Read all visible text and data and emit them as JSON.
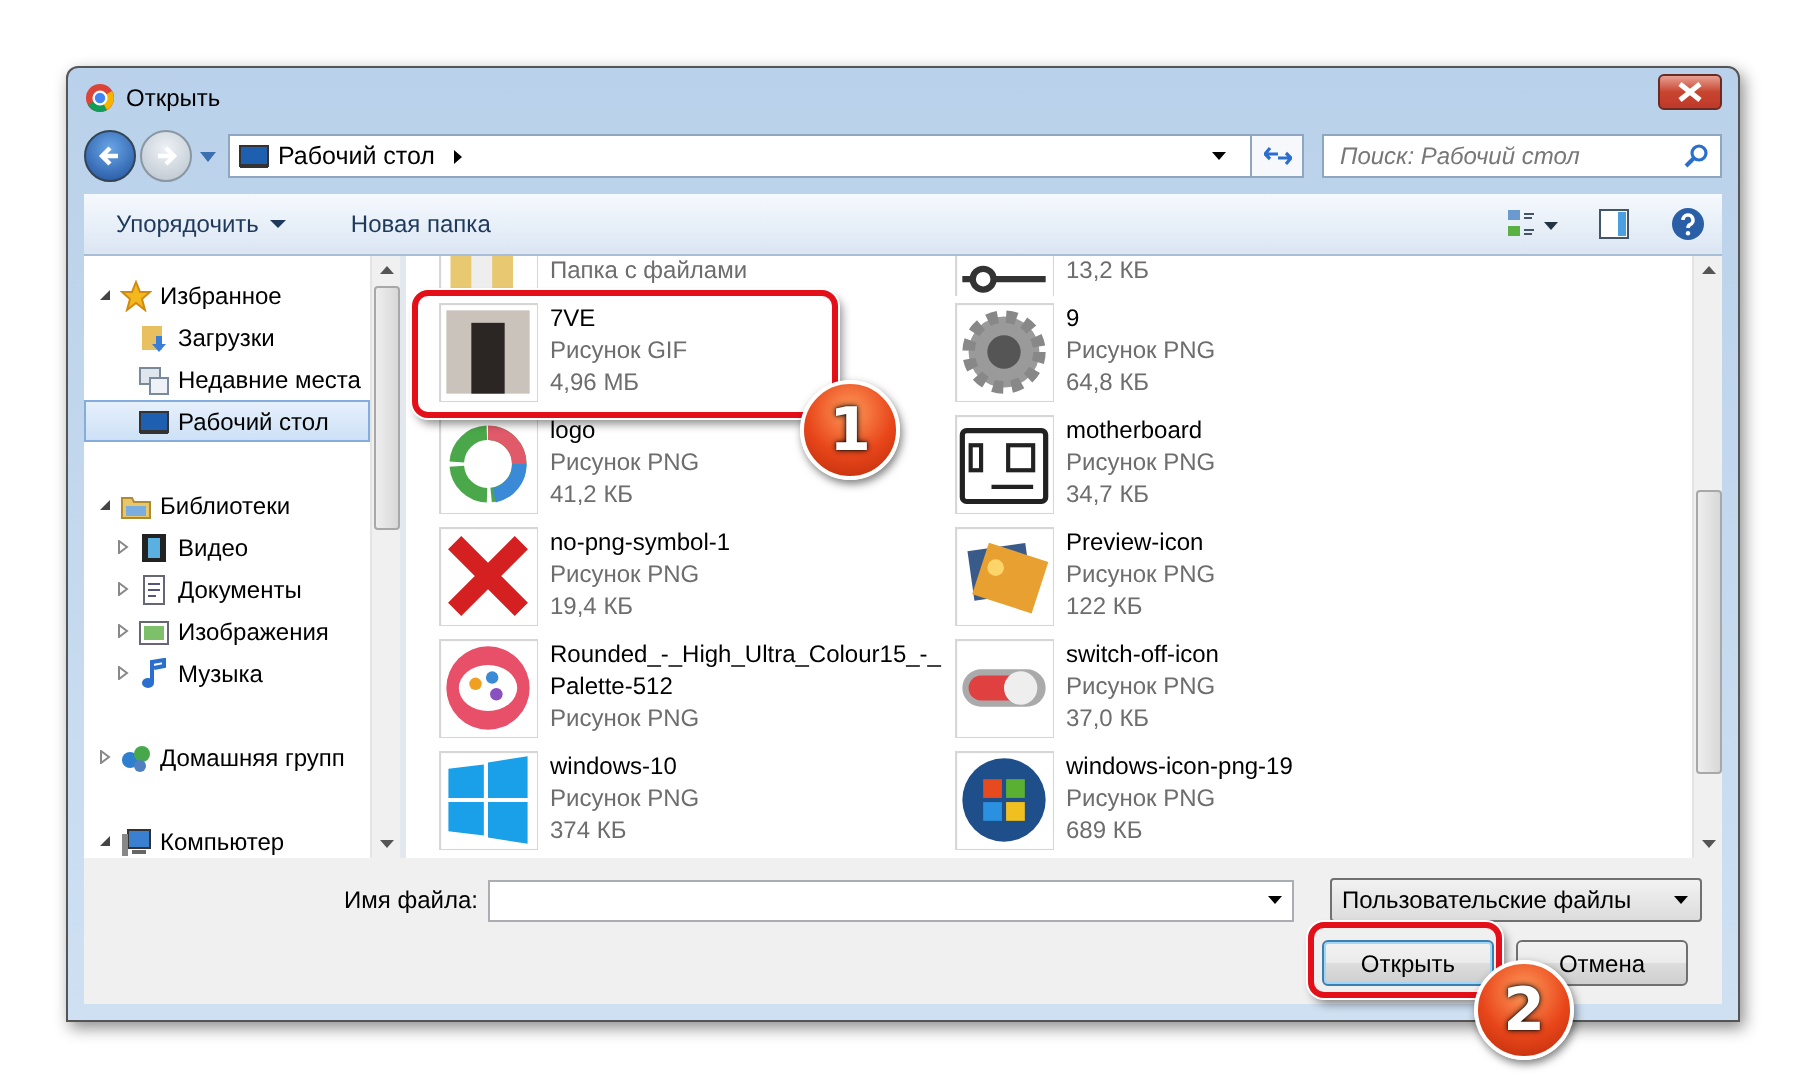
{
  "window": {
    "title": "Открыть"
  },
  "nav": {
    "back_enabled": true,
    "forward_enabled": false,
    "address": "Рабочий стол",
    "search_placeholder": "Поиск: Рабочий стол"
  },
  "toolbar": {
    "organize": "Упорядочить",
    "new_folder": "Новая папка"
  },
  "sidebar": {
    "items": [
      {
        "label": "Избранное",
        "expanded": true,
        "selected": false,
        "children": [
          {
            "label": "Загрузки",
            "selected": false
          },
          {
            "label": "Недавние места",
            "selected": false
          },
          {
            "label": "Рабочий стол",
            "selected": true
          }
        ]
      },
      {
        "label": "Библиотеки",
        "expanded": true,
        "selected": false,
        "children": [
          {
            "label": "Видео",
            "expanded": false,
            "selected": false
          },
          {
            "label": "Документы",
            "expanded": false,
            "selected": false
          },
          {
            "label": "Изображения",
            "expanded": false,
            "selected": false
          },
          {
            "label": "Музыка",
            "expanded": false,
            "selected": false
          }
        ]
      },
      {
        "label": "Домашняя групп",
        "expanded": false,
        "selected": false
      },
      {
        "label": "Компьютер",
        "expanded": true,
        "selected": false
      }
    ]
  },
  "files": [
    {
      "type": "Папка с файлами"
    },
    {
      "size": "13,2 КБ"
    },
    {
      "name": "7VE",
      "type": "Рисунок GIF",
      "size": "4,96 МБ"
    },
    {
      "name": "9",
      "type": "Рисунок PNG",
      "size": "64,8 КБ"
    },
    {
      "name": "logo",
      "type": "Рисунок PNG",
      "size": "41,2 КБ"
    },
    {
      "name": "motherboard",
      "type": "Рисунок PNG",
      "size": "34,7 КБ"
    },
    {
      "name": "no-png-symbol-1",
      "type": "Рисунок PNG",
      "size": "19,4 КБ"
    },
    {
      "name": "Preview-icon",
      "type": "Рисунок PNG",
      "size": "122 КБ"
    },
    {
      "name": "Rounded_-_High_Ultra_Colour15_-_\nPalette-512",
      "type": "Рисунок PNG"
    },
    {
      "name": "switch-off-icon",
      "type": "Рисунок PNG",
      "size": "37,0 КБ"
    },
    {
      "name": "windows-10",
      "type": "Рисунок PNG",
      "size": "374 КБ"
    },
    {
      "name": "windows-icon-png-19",
      "type": "Рисунок PNG",
      "size": "689 КБ"
    }
  ],
  "bottom": {
    "filename_label": "Имя файла:",
    "filter": "Пользовательские файлы",
    "buttons": [
      {
        "label": "Открыть",
        "default": true
      },
      {
        "label": "Отмена",
        "default": false
      }
    ]
  },
  "annotations": [
    {
      "kind": "file-callout",
      "label": "1"
    },
    {
      "kind": "button-callout",
      "label": "2"
    }
  ]
}
